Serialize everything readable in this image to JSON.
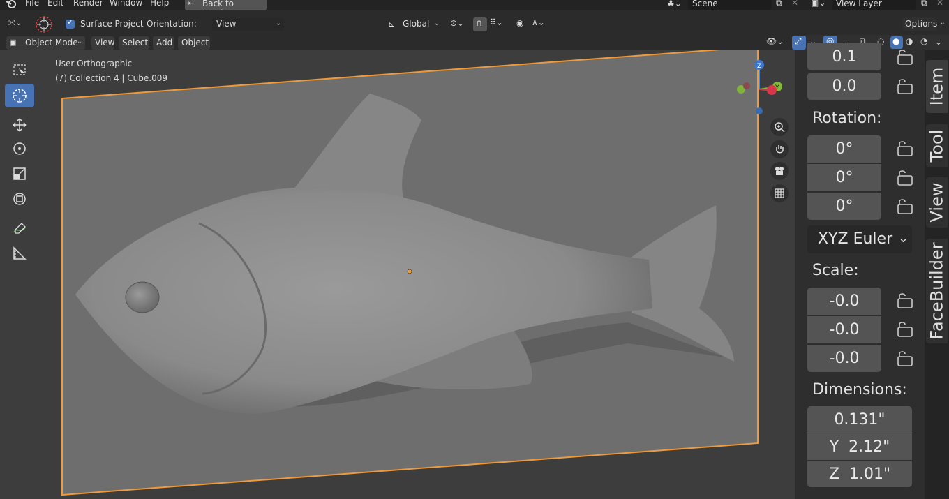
{
  "menu": {
    "items": [
      "File",
      "Edit",
      "Render",
      "Window",
      "Help"
    ],
    "back_button": "Back to Previous"
  },
  "scene": {
    "name": "Scene",
    "view_layer": "View Layer"
  },
  "tool_settings": {
    "surface_project": "Surface Project",
    "orientation_label": "Orientation:",
    "orientation_value": "View",
    "transform_orientation": "Global",
    "options": "Options"
  },
  "viewport_header": {
    "mode": "Object Mode",
    "menus": [
      "View",
      "Select",
      "Add",
      "Object"
    ]
  },
  "viewport": {
    "view_name": "User Orthographic",
    "collection_info": "(7) Collection 4 | Cube.009"
  },
  "gizmo": {
    "z": "Z",
    "y": "Y"
  },
  "sidebar": {
    "location": [
      "0.1",
      "0.0"
    ],
    "rotation_label": "Rotation:",
    "rotation": [
      "0°",
      "0°",
      "0°"
    ],
    "rotation_mode": "XYZ Euler",
    "scale_label": "Scale:",
    "scale": [
      "-0.0",
      "-0.0",
      "-0.0"
    ],
    "dimensions_label": "Dimensions:",
    "dimensions": [
      "0.131\"",
      "Y  2.12\"",
      "Z  1.01\""
    ]
  },
  "tabs": [
    "Item",
    "Tool",
    "View",
    "FaceBuilder"
  ],
  "colors": {
    "accent": "#4772b3",
    "selection": "#f09a3a",
    "plane": "#6e6e6e",
    "model": "#8c8c8c"
  }
}
